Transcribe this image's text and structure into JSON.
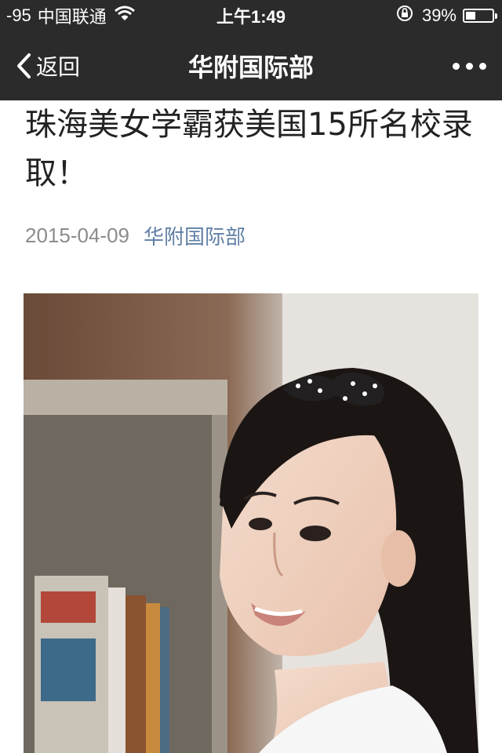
{
  "status_bar": {
    "signal": "-95",
    "carrier": "中国联通",
    "time": "上午1:49",
    "battery_percent": "39%",
    "battery_level": 0.39,
    "icons": [
      "wifi-icon",
      "orientation-lock-icon",
      "battery-icon"
    ]
  },
  "nav": {
    "back_label": "返回",
    "title": "华附国际部",
    "icons": [
      "chevron-left-icon",
      "more-dots-icon"
    ]
  },
  "article": {
    "title": "珠海美女学霸获美国15所名校录取！",
    "date": "2015-04-09",
    "source": "华附国际部",
    "image_description_icon": "photo-girl-with-bow"
  },
  "colors": {
    "bar_background": "#2b2b2c",
    "title_text": "#222222",
    "date_text": "#8c8c8c",
    "link_text": "#607fa6"
  }
}
